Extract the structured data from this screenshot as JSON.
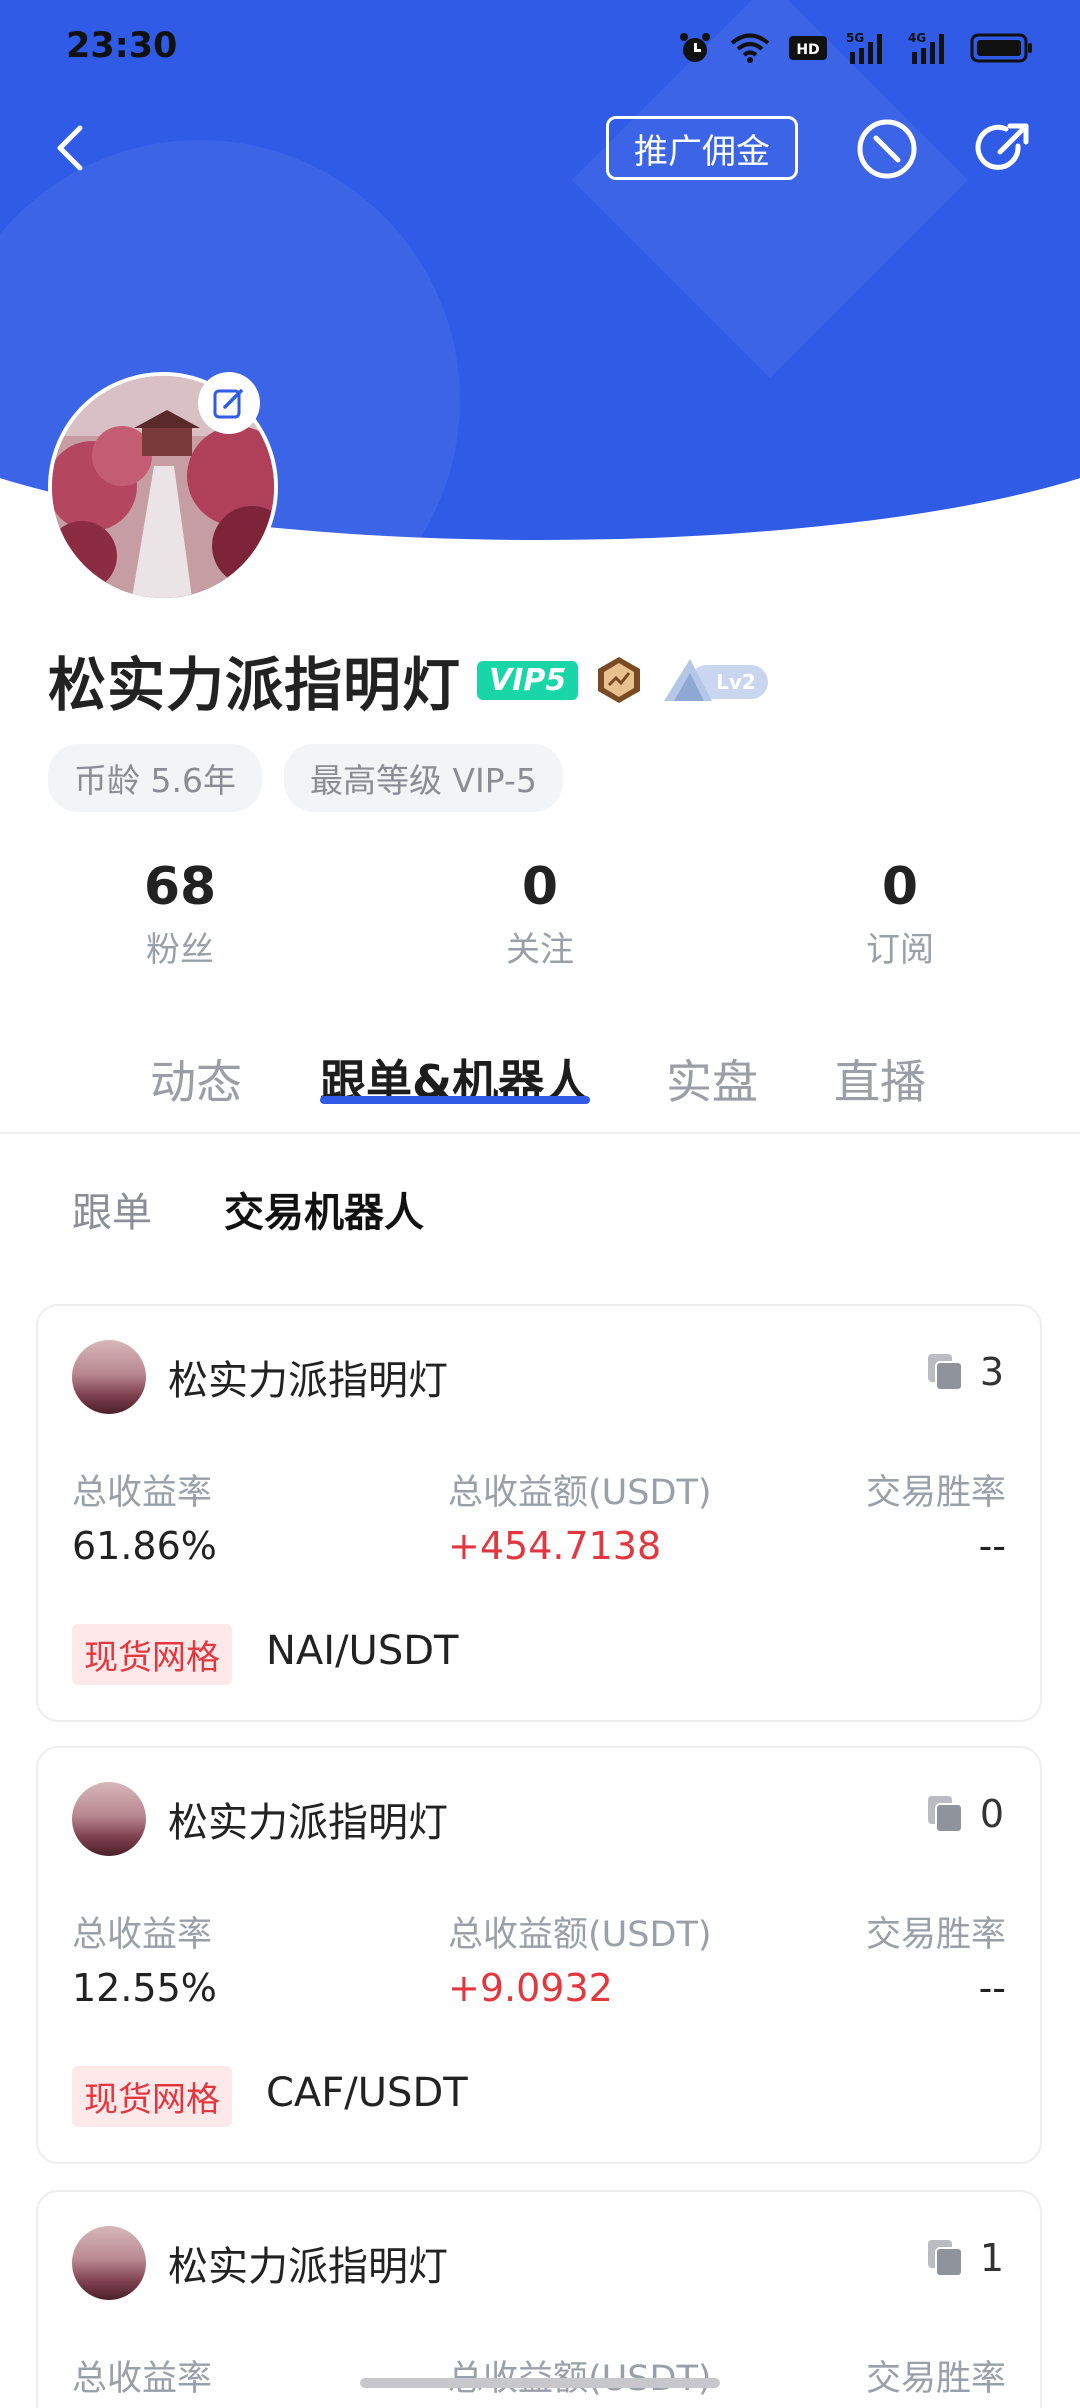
{
  "status_bar": {
    "time": "23:30"
  },
  "nav": {
    "promo_label": "推广佣金"
  },
  "profile": {
    "name": "松实力派指明灯",
    "vip_badge": "VIP5",
    "lv_badge": "Lv2",
    "chips": [
      "币龄 5.6年",
      "最高等级 VIP-5"
    ]
  },
  "stats": [
    {
      "value": "68",
      "label": "粉丝"
    },
    {
      "value": "0",
      "label": "关注"
    },
    {
      "value": "0",
      "label": "订阅"
    }
  ],
  "tabs": [
    "动态",
    "跟单&机器人",
    "实盘",
    "直播"
  ],
  "active_tab": "跟单&机器人",
  "subtabs": [
    "跟单",
    "交易机器人"
  ],
  "active_subtab": "交易机器人",
  "labels": {
    "total_rate": "总收益率",
    "total_amount": "总收益额(USDT)",
    "win_rate": "交易胜率"
  },
  "cards": [
    {
      "name": "松实力派指明灯",
      "copy_count": "3",
      "rate": "61.86%",
      "amount": "+454.7138",
      "win": "--",
      "tag": "现货网格",
      "pair": "NAI/USDT"
    },
    {
      "name": "松实力派指明灯",
      "copy_count": "0",
      "rate": "12.55%",
      "amount": "+9.0932",
      "win": "--",
      "tag": "现货网格",
      "pair": "CAF/USDT"
    },
    {
      "name": "松实力派指明灯",
      "copy_count": "1"
    }
  ],
  "colors": {
    "brand_blue": "#2f5be6",
    "vip_green": "#19d6a8",
    "profit_red": "#e3373f"
  }
}
